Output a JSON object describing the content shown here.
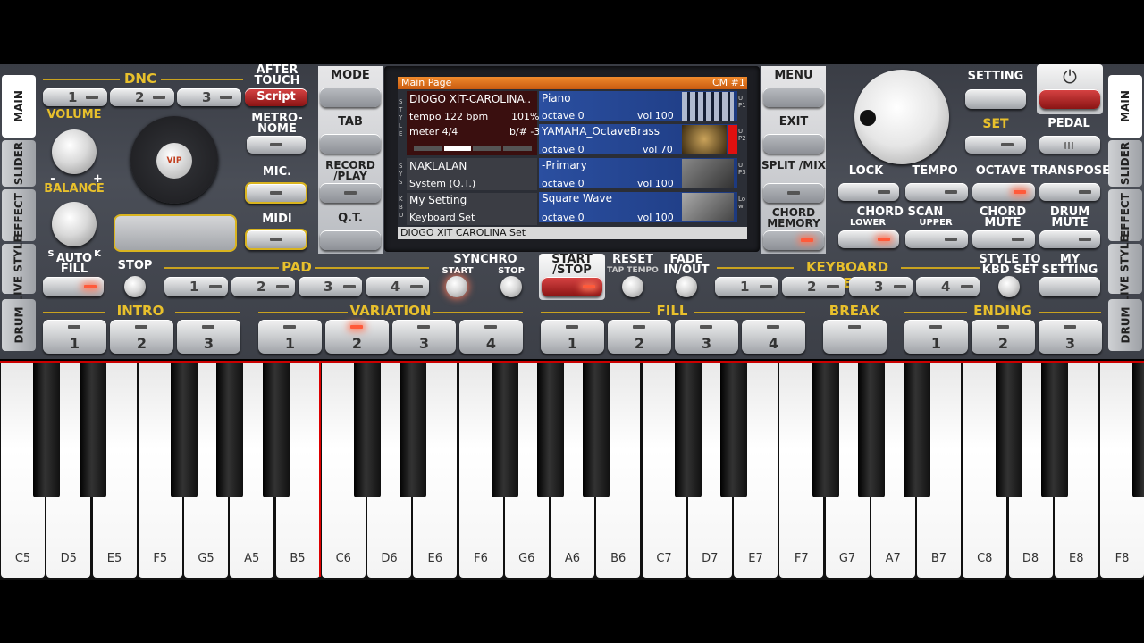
{
  "tabs_left": [
    "MAIN",
    "SLIDER",
    "EFFECT",
    "LIVE STYLE",
    "DRUM"
  ],
  "tabs_right": [
    "MAIN",
    "SLIDER",
    "EFFECT",
    "LIVE STYLE",
    "DRUM"
  ],
  "dnc": {
    "title": "DNC",
    "buttons": [
      "1",
      "2",
      "3"
    ],
    "script": "Script"
  },
  "after_touch": "AFTER TOUCH",
  "metronome": "METRO- NOME",
  "mic": "MIC.",
  "midi": "MIDI",
  "volume": "VOLUME",
  "balance": "BALANCE",
  "balance_s": "S",
  "balance_k": "K",
  "vol_minus": "-",
  "vol_plus": "+",
  "vip": "VIP",
  "mid_left": [
    "MODE",
    "TAB",
    "RECORD /PLAY",
    "Q.T."
  ],
  "mid_right": [
    "MENU",
    "EXIT",
    "SPLIT /MIX",
    "CHORD MEMORY"
  ],
  "screen": {
    "header": "Main Page",
    "header_right": "CM #1",
    "style_name": "DIOGO XiT-CAROLINA..",
    "tempo": "tempo 122 bpm",
    "tempo_pct": "101%",
    "meter": "meter 4/4",
    "transpose": "b/# -3",
    "system_name": "NAKLALAN",
    "system_sub": "System (Q.T.)",
    "kbd_name": "My Setting",
    "kbd_sub": "Keyboard Set",
    "side_left": "STYLE",
    "side_left2": "SYS",
    "side_left3": "KBD",
    "side_right": [
      "UP1",
      "UP2",
      "UP3",
      "Low"
    ],
    "voices": [
      {
        "name": "Piano",
        "octave": "octave  0",
        "vol": "vol 100"
      },
      {
        "name": "YAMAHA_OctaveBrass",
        "octave": "octave  0",
        "vol": "vol 70"
      },
      {
        "name": "-Primary",
        "octave": "octave  0",
        "vol": "vol 100"
      },
      {
        "name": "Square Wave",
        "octave": "octave  0",
        "vol": "vol 100"
      }
    ],
    "footer": "DIOGO XiT CAROLINA Set"
  },
  "setting": "SETTING",
  "set": "SET",
  "pedal": "PEDAL",
  "lock": "LOCK",
  "tempo": "TEMPO",
  "octave": "OCTAVE",
  "transpose_lbl": "TRANSPOSE",
  "chord_scan": "CHORD SCAN",
  "lower": "LOWER",
  "upper": "UPPER",
  "chord_mute": "CHORD MUTE",
  "drum_mute": "DRUM MUTE",
  "auto_fill": "AUTO FILL",
  "stop": "STOP",
  "pad": {
    "title": "PAD",
    "buttons": [
      "1",
      "2",
      "3",
      "4"
    ]
  },
  "synchro": "SYNCHRO",
  "synchro_start": "START",
  "synchro_stop": "STOP",
  "start_stop": "START /STOP",
  "reset": "RESET",
  "tap_tempo": "TAP TEMPO",
  "fade": "FADE IN/OUT",
  "keyboard_set": {
    "title": "KEYBOARD SET",
    "buttons": [
      "1",
      "2",
      "3",
      "4"
    ]
  },
  "style_to_kbd": "STYLE TO KBD SET",
  "my_setting": "MY SETTING",
  "intro": {
    "title": "INTRO",
    "buttons": [
      "1",
      "2",
      "3"
    ]
  },
  "variation": {
    "title": "VARIATION",
    "buttons": [
      "1",
      "2",
      "3",
      "4"
    ]
  },
  "fill": {
    "title": "FILL",
    "buttons": [
      "1",
      "2",
      "3",
      "4"
    ]
  },
  "break": {
    "title": "BREAK"
  },
  "ending": {
    "title": "ENDING",
    "buttons": [
      "1",
      "2",
      "3"
    ]
  },
  "white_keys": [
    "C5",
    "D5",
    "E5",
    "F5",
    "G5",
    "A5",
    "B5",
    "C6",
    "D6",
    "E6",
    "F6",
    "G6",
    "A6",
    "B6",
    "C7",
    "D7",
    "E7",
    "F7",
    "G7",
    "A7",
    "B7",
    "C8",
    "D8",
    "E8",
    "F8"
  ],
  "colors": {
    "accent": "#e8c02c",
    "led_on": "#ff5a3a",
    "screen_header": "#e8771c",
    "red_line": "#cc0000"
  }
}
